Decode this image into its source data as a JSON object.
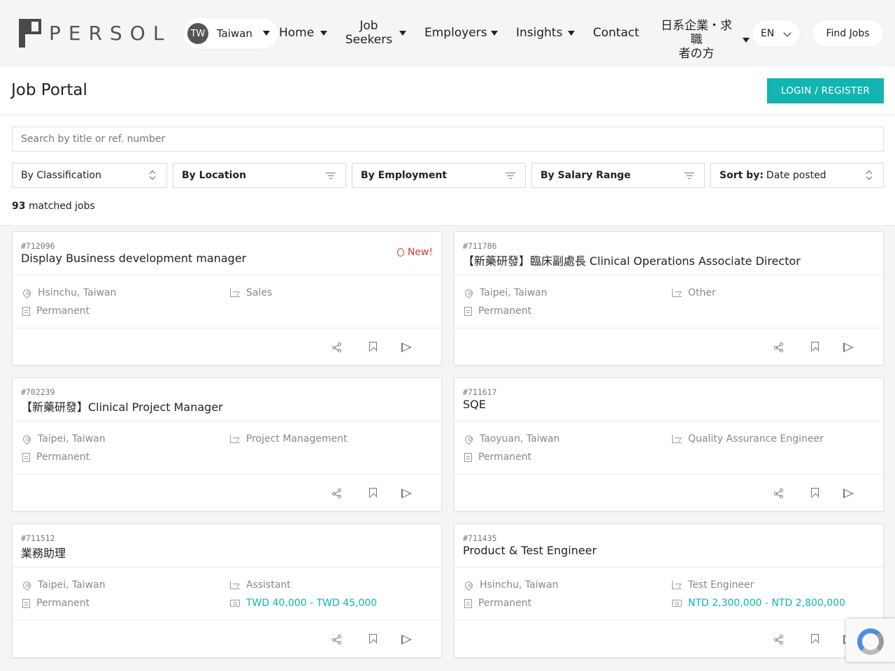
{
  "brand": {
    "logo_text": "PERSOL"
  },
  "country": {
    "code": "TW",
    "name": "Taiwan"
  },
  "nav": {
    "home": "Home",
    "job_seekers_1": "Job",
    "job_seekers_2": "Seekers",
    "employers": "Employers",
    "insights": "Insights",
    "contact": "Contact",
    "japanese_1": "日系企業・求職",
    "japanese_2": "者の方",
    "lang": "EN",
    "find_jobs": "Find Jobs"
  },
  "portal": {
    "title": "Job Portal",
    "login_label": "LOGIN / REGISTER"
  },
  "filters": {
    "search_placeholder": "Search by title or ref. number",
    "classification": "By Classification",
    "location": "By Location",
    "employment": "By Employment",
    "salary": "By Salary Range",
    "sort_label": "Sort by:",
    "sort_value": "Date posted",
    "matched_count": "93",
    "matched_suffix": "matched jobs"
  },
  "jobs": [
    {
      "ref": "#712096",
      "title": "Display Business development manager",
      "badge": "New!",
      "location": "Hsinchu, Taiwan",
      "employment": "Permanent",
      "category": "Sales",
      "salary": ""
    },
    {
      "ref": "#711786",
      "title": "【新藥研發】臨床副處長 Clinical Operations Associate Director",
      "badge": "",
      "location": "Taipei, Taiwan",
      "employment": "Permanent",
      "category": "Other",
      "salary": ""
    },
    {
      "ref": "#702239",
      "title": "【新藥研發】Clinical Project Manager",
      "badge": "",
      "location": "Taipei, Taiwan",
      "employment": "Permanent",
      "category": "Project Management",
      "salary": ""
    },
    {
      "ref": "#711617",
      "title": "SQE",
      "badge": "",
      "location": "Taoyuan, Taiwan",
      "employment": "Permanent",
      "category": "Quality Assurance Engineer",
      "salary": ""
    },
    {
      "ref": "#711512",
      "title": "業務助理",
      "badge": "",
      "location": "Taipei, Taiwan",
      "employment": "Permanent",
      "category": "Assistant",
      "salary": "TWD 40,000 - TWD 45,000"
    },
    {
      "ref": "#711435",
      "title": "Product & Test Engineer",
      "badge": "",
      "location": "Hsinchu, Taiwan",
      "employment": "Permanent",
      "category": "Test Engineer",
      "salary": "NTD 2,300,000 - NTD 2,800,000"
    }
  ],
  "colors": {
    "accent": "#12b5b0",
    "new_badge": "#d83a3a"
  }
}
